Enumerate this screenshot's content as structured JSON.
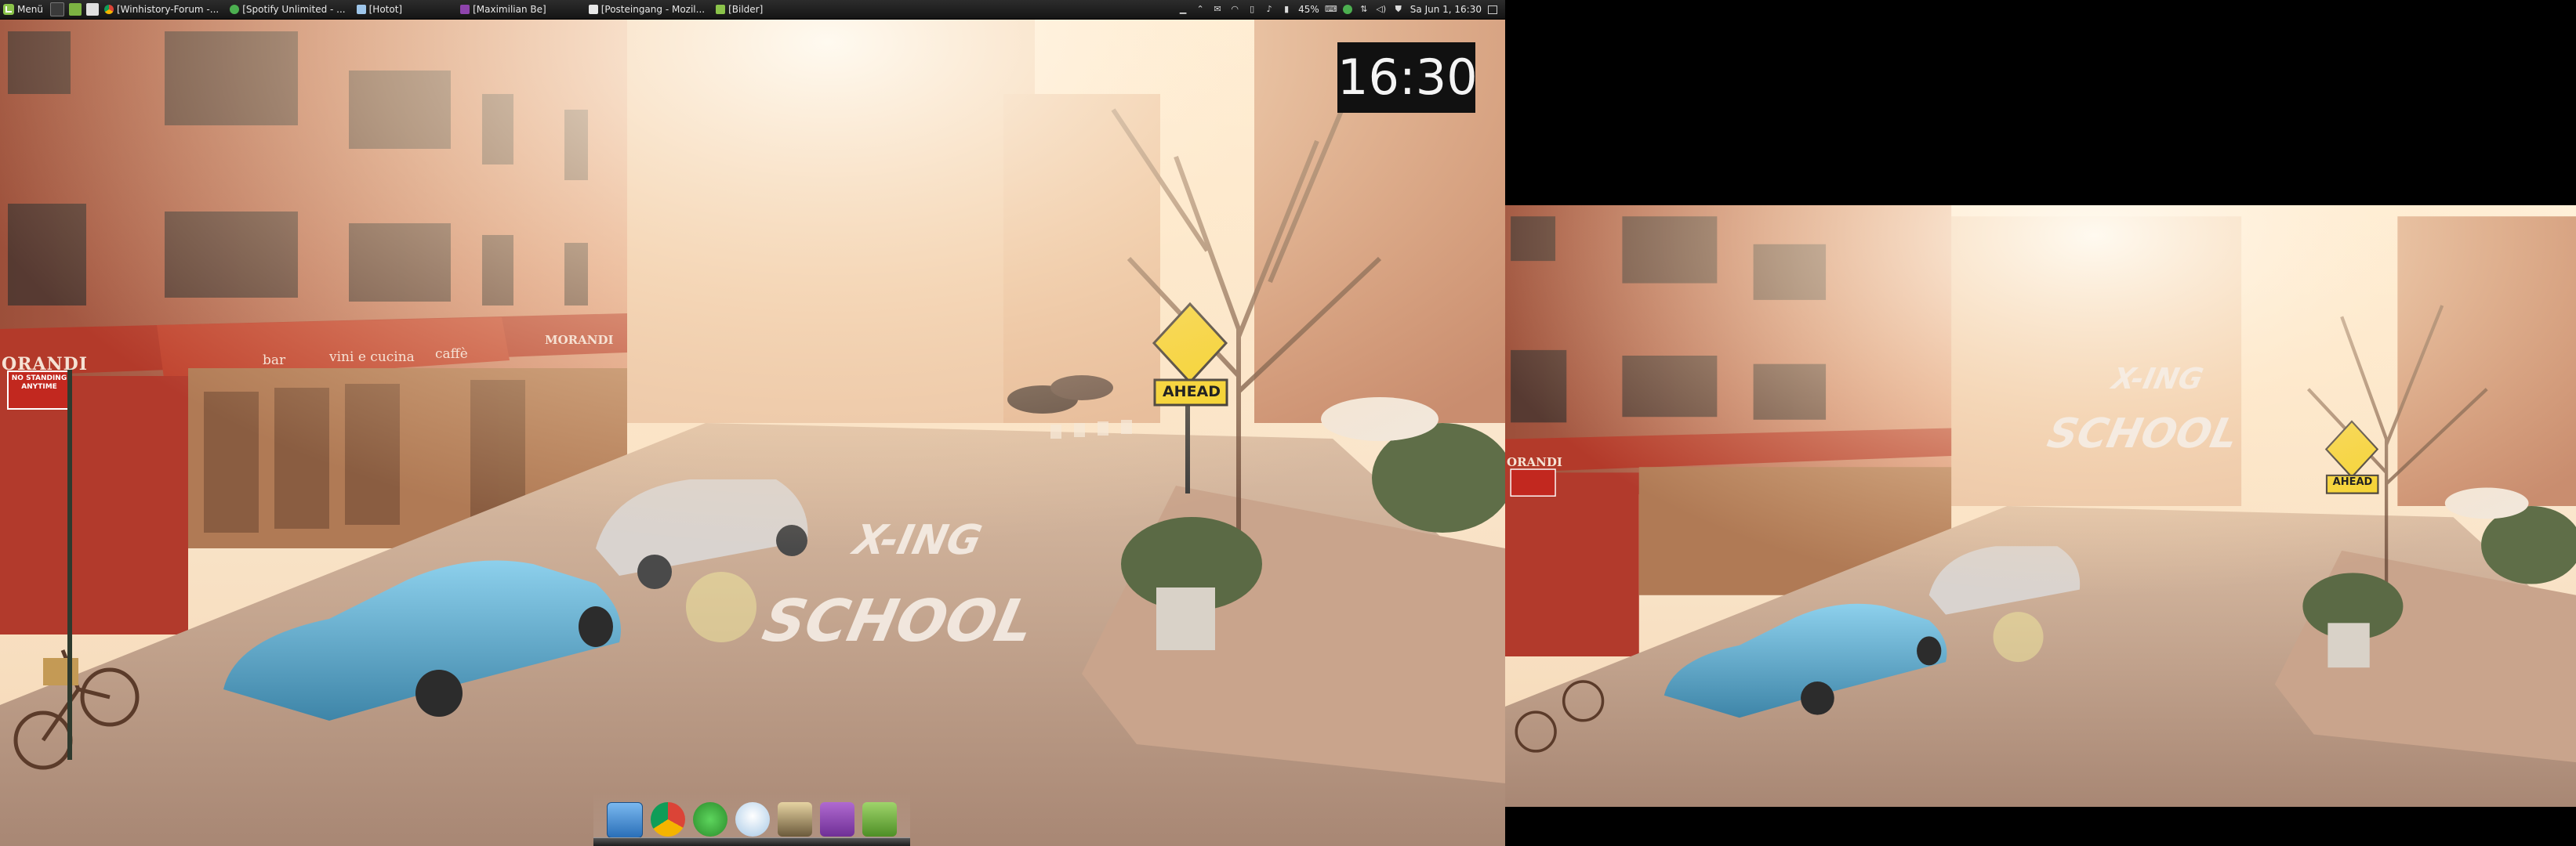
{
  "top_panel": {
    "menu_label": "Menü",
    "launchers": [
      "terminal-icon",
      "files-icon",
      "text-editor-icon"
    ],
    "tasks": [
      {
        "icon": "chrome-icon",
        "label": "[Winhistory-Forum -..."
      },
      {
        "icon": "spotify-icon",
        "label": "[Spotify Unlimited - ..."
      },
      {
        "icon": "hotot-icon",
        "label": "[Hotot]"
      },
      {
        "icon": "chat-icon",
        "label": "[Maximilian Be]"
      },
      {
        "icon": "thunderbird-icon",
        "label": "[Posteingang - Mozil..."
      },
      {
        "icon": "folder-icon",
        "label": "[Bilder]"
      }
    ],
    "tray": {
      "battery": "45%",
      "datetime": "Sa Jun  1, 16:30"
    }
  },
  "clock": {
    "time": "16:30"
  },
  "dock": {
    "icons": [
      "app-store-icon",
      "chrome-icon",
      "spotify-icon",
      "hotot-icon",
      "thunderbird-icon",
      "chat-icon",
      "files-icon"
    ]
  },
  "wallpaper": {
    "shop_sign": "ORANDI",
    "awning_text_1": "bar",
    "awning_text_2": "vini e cucina",
    "awning_text_3": "caffè",
    "awning_right": "MORANDI",
    "parking_sign_line1": "NO STANDING",
    "parking_sign_line2": "ANYTIME",
    "road_word_1": "X-ING",
    "road_word_2": "SCHOOL",
    "school_sign": "AHEAD"
  },
  "colors": {
    "panel": "#1c1c1c",
    "car_blue": "#5aa6c8",
    "brick": "#b8654a",
    "awning": "#b33a2a",
    "sign_yellow": "#f3d21b",
    "sky_glow": "#fff2d6"
  }
}
